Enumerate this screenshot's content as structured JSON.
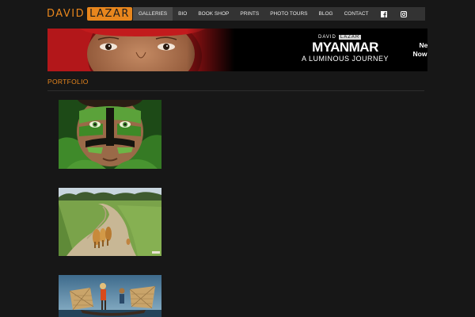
{
  "header": {
    "logo_first": "DAVID",
    "logo_last": "LAZAR",
    "accent_color": "#e8861d"
  },
  "nav": {
    "items": [
      {
        "label": "GALLERIES",
        "active": true
      },
      {
        "label": "BIO",
        "active": false
      },
      {
        "label": "BOOK SHOP",
        "active": false
      },
      {
        "label": "PRINTS",
        "active": false
      },
      {
        "label": "PHOTO TOURS",
        "active": false
      },
      {
        "label": "BLOG",
        "active": false
      },
      {
        "label": "CONTACT",
        "active": false
      }
    ],
    "icons": [
      "facebook-icon",
      "instagram-icon"
    ]
  },
  "banner": {
    "author_first": "DAVID",
    "author_last": "LAZAR",
    "title": "MYANMAR",
    "subtitle": "A LUMINOUS JOURNEY",
    "promo_line1": "New Book",
    "promo_line2": "Now Available"
  },
  "section": {
    "title": "PORTFOLIO"
  },
  "thumbnails": [
    {
      "subject": "child-with-green-face-paint"
    },
    {
      "subject": "dirt-road-with-animals"
    },
    {
      "subject": "fisherman-on-boat"
    }
  ]
}
